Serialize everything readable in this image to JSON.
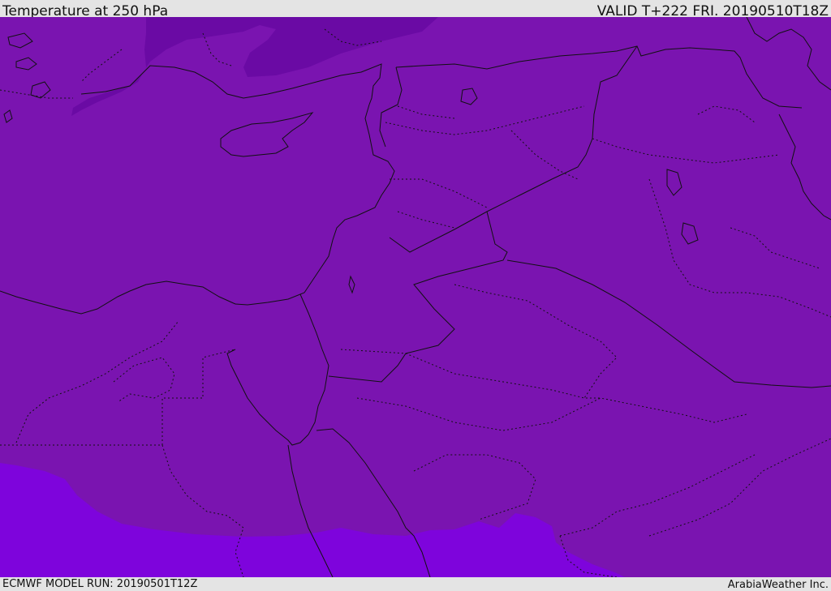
{
  "header": {
    "title": "Temperature at 250 hPa",
    "valid": "VALID T+222 FRI. 20190510T18Z"
  },
  "footer": {
    "model_run": "ECMWF MODEL RUN: 20190501T12Z",
    "credit": "ArabiaWeather Inc."
  },
  "colors": {
    "base_fill": "#7a14b0",
    "cold_fill": "#6608a0",
    "warm_fill": "#7e04dc",
    "borders": "#111111",
    "frame": "#e4e4e4"
  }
}
